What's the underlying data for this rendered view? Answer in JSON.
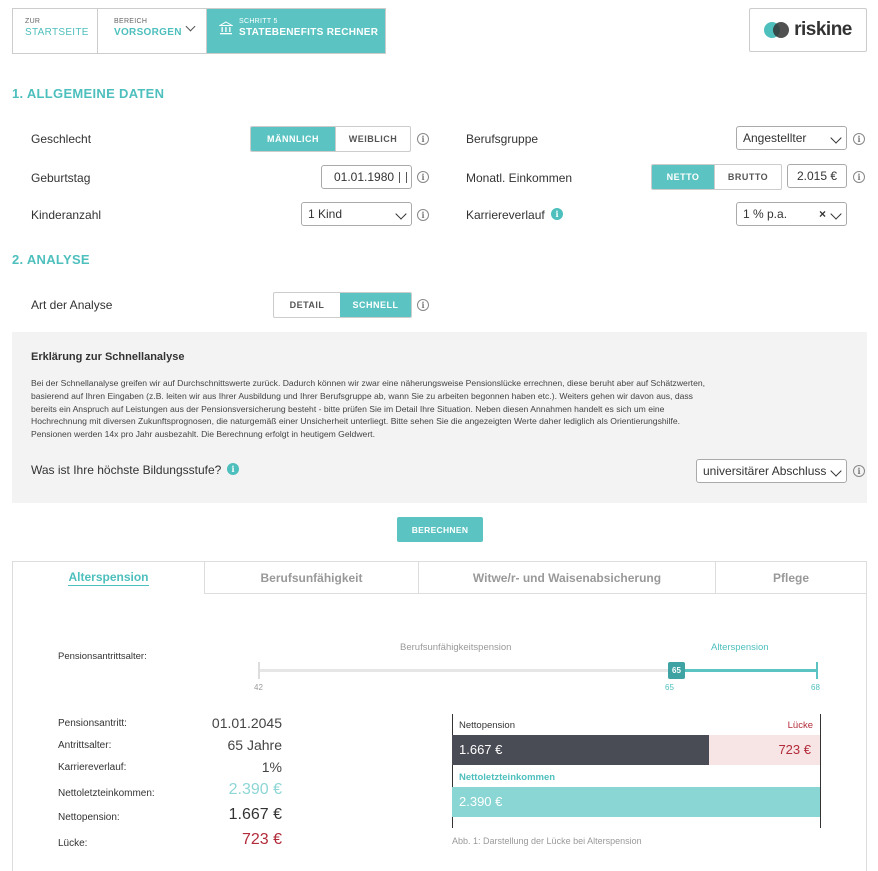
{
  "breadcrumb": {
    "home": {
      "small": "ZUR",
      "label": "STARTSEITE"
    },
    "area": {
      "small": "BEREICH",
      "label": "VORSORGEN"
    },
    "step": {
      "small": "SCHRITT 5",
      "label": "STATEBENEFITS RECHNER"
    }
  },
  "logo": {
    "text": "riskine"
  },
  "section1": {
    "title": "1. ALLGEMEINE DATEN",
    "gender": {
      "label": "Geschlecht",
      "options": [
        "MÄNNLICH",
        "WEIBLICH"
      ],
      "selected": "MÄNNLICH"
    },
    "birthday": {
      "label": "Geburtstag",
      "value": "01.01.1980"
    },
    "children": {
      "label": "Kinderanzahl",
      "value": "1 Kind"
    },
    "profession": {
      "label": "Berufsgruppe",
      "value": "Angestellter"
    },
    "income": {
      "label": "Monatl. Einkommen",
      "options": [
        "NETTO",
        "BRUTTO"
      ],
      "selected": "NETTO",
      "value": "2.015 €"
    },
    "career": {
      "label": "Karriereverlauf",
      "value": "1 % p.a."
    }
  },
  "section2": {
    "title": "2. ANALYSE",
    "type": {
      "label": "Art der Analyse",
      "options": [
        "DETAIL",
        "SCHNELL"
      ],
      "selected": "SCHNELL"
    },
    "explain": {
      "title": "Erklärung zur Schnellanalyse",
      "lines": [
        "Bei der Schnellanalyse greifen wir auf Durchschnittswerte zurück. Dadurch können wir zwar eine näherungsweise Pensionslücke errechnen, diese beruht aber auf Schätzwerten,",
        "basierend auf Ihren Eingaben (z.B. leiten wir aus Ihrer Ausbildung und Ihrer Berufsgruppe ab, wann Sie zu arbeiten begonnen haben etc.). Weiters gehen wir davon aus, dass",
        "bereits ein Anspruch auf Leistungen aus der Pensionsversicherung besteht - bitte prüfen Sie im Detail Ihre Situation. Neben diesen Annahmen handelt es sich um eine",
        "Hochrechnung mit diversen Zukunftsprognosen, die naturgemäß einer Unsicherheit unterliegt. Bitte sehen Sie die angezeigten Werte daher lediglich als Orientierungshilfe.",
        "Pensionen werden 14x pro Jahr ausbezahlt. Die Berechnung erfolgt in heutigem Geldwert."
      ],
      "education_label": "Was ist Ihre höchste Bildungsstufe?",
      "education_value": "universitärer Abschluss"
    },
    "calc_button": "BERECHNEN"
  },
  "tabs": [
    "Alterspension",
    "Berufsunfähigkeit",
    "Witwe/r- und Waisenabsicherung",
    "Pflege"
  ],
  "result": {
    "slider": {
      "label": "Pensionsantrittsalter:",
      "left_label": "Berufsunfähigkeitspension",
      "right_label": "Alterspension",
      "min": "42",
      "value": "65",
      "max": "68",
      "value_label": "65"
    },
    "details": [
      {
        "key": "Pensionsantritt:",
        "value": "01.01.2045"
      },
      {
        "key": "Antrittsalter:",
        "value": "65 Jahre"
      },
      {
        "key": "Karriereverlauf:",
        "value": "1%"
      },
      {
        "key": "Nettoletzteinkommen:",
        "value": "2.390 €"
      },
      {
        "key": "Nettopension:",
        "value": "1.667 €"
      },
      {
        "key": "Lücke:",
        "value": "723 €"
      }
    ],
    "chart": {
      "netto_label": "Nettopension",
      "gap_label": "Lücke",
      "netto_value": "1.667 €",
      "gap_value": "723 €",
      "last_label": "Nettoletzteinkommen",
      "last_value": "2.390 €",
      "caption": "Abb. 1: Darstellung der Lücke bei Alterspension"
    },
    "chart_data": {
      "type": "bar",
      "categories": [
        "Nettopension",
        "Lücke",
        "Nettoletzteinkommen"
      ],
      "values": [
        1667,
        723,
        2390
      ]
    }
  },
  "colors": {
    "accent": "#4dbfbd",
    "dark": "#4a4c55",
    "gap": "#f7e4e4",
    "gap_text": "#b22b3a"
  }
}
